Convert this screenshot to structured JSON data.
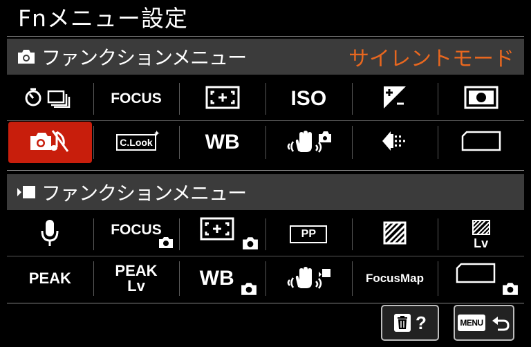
{
  "header": {
    "title": "Fnメニュー設定"
  },
  "photo_section": {
    "label": "ファンクションメニュー",
    "extra": "サイレントモード",
    "icon": "camera-icon",
    "row1": [
      {
        "name": "drive-mode-icon"
      },
      {
        "name": "focus-mode-item",
        "text": "FOCUS"
      },
      {
        "name": "focus-area-icon"
      },
      {
        "name": "iso-item",
        "text": "ISO"
      },
      {
        "name": "exposure-comp-icon"
      },
      {
        "name": "metering-mode-icon"
      }
    ],
    "row2": [
      {
        "name": "silent-mode-icon",
        "selected": true
      },
      {
        "name": "creative-look-icon",
        "text": "C.Look"
      },
      {
        "name": "white-balance-item",
        "text": "WB"
      },
      {
        "name": "steadyshot-photo-icon"
      },
      {
        "name": "file-format-icon"
      },
      {
        "name": "empty-slot"
      }
    ]
  },
  "movie_section": {
    "label": "ファンクションメニュー",
    "icon": "movie-icon",
    "row1": [
      {
        "name": "microphone-icon"
      },
      {
        "name": "focus-mode-movie-item",
        "text": "FOCUS"
      },
      {
        "name": "focus-area-movie-icon"
      },
      {
        "name": "picture-profile-item",
        "text": "PP"
      },
      {
        "name": "zebra-icon"
      },
      {
        "name": "zebra-lv-item",
        "text": "Lv"
      }
    ],
    "row2": [
      {
        "name": "peaking-item",
        "text": "PEAK"
      },
      {
        "name": "peaking-lv-item",
        "text": "PEAK",
        "text2": "Lv"
      },
      {
        "name": "white-balance-movie-item",
        "text": "WB"
      },
      {
        "name": "steadyshot-movie-icon"
      },
      {
        "name": "focus-map-item",
        "text": "FocusMap"
      },
      {
        "name": "empty-slot-movie"
      }
    ]
  },
  "footer": {
    "delete_label": "?",
    "menu_label": "MENU"
  },
  "colors": {
    "accent": "#e8671f",
    "selected": "#c81e0c",
    "section_bg": "#3b3b3b"
  }
}
